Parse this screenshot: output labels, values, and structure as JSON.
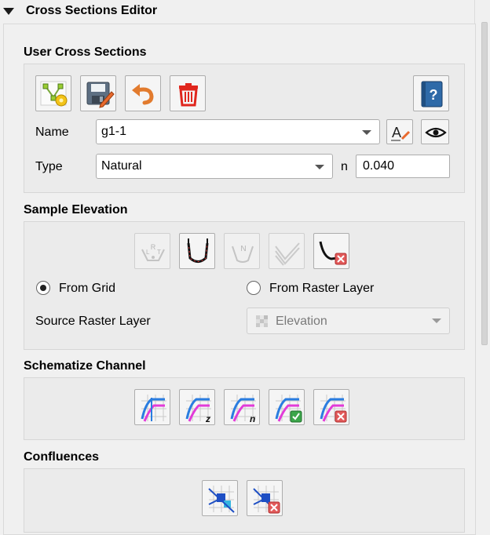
{
  "panel": {
    "title": "Cross Sections Editor"
  },
  "user_cross_sections": {
    "title": "User Cross Sections",
    "name_label": "Name",
    "name_value": "g1-1",
    "type_label": "Type",
    "type_value": "Natural",
    "n_label": "n",
    "n_value": "0.040"
  },
  "sample_elevation": {
    "title": "Sample Elevation",
    "from_grid_label": "From Grid",
    "from_grid_selected": true,
    "from_raster_label": "From Raster Layer",
    "from_raster_selected": false,
    "source_raster_label": "Source Raster Layer",
    "source_raster_value": "Elevation"
  },
  "schematize_channel": {
    "title": "Schematize Channel"
  },
  "confluences": {
    "title": "Confluences"
  },
  "icons": {
    "digitize": "digitize-cross-section-icon",
    "save": "save-icon",
    "undo": "undo-icon",
    "delete": "trash-icon",
    "help": "help-book-icon",
    "rename": "rename-icon",
    "view": "eye-icon"
  }
}
